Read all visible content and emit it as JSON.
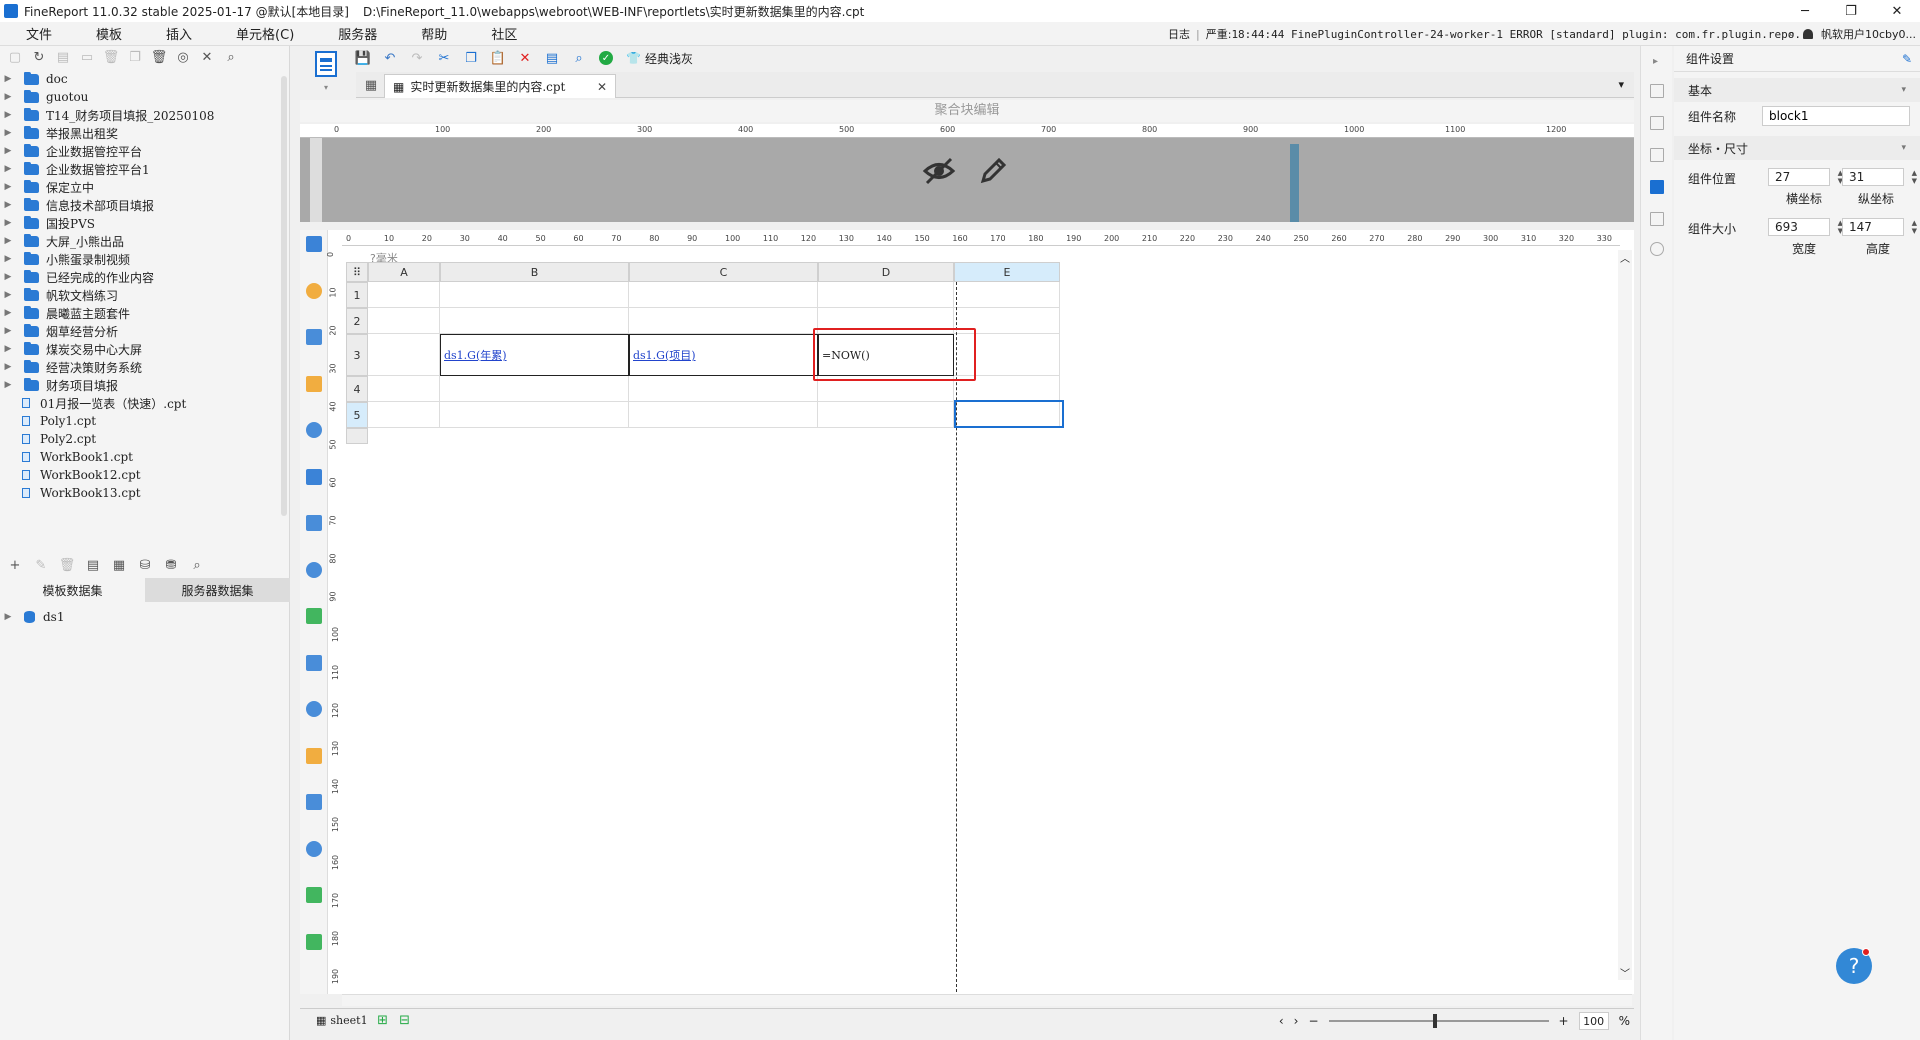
{
  "window": {
    "title": "FineReport 11.0.32 stable 2025-01-17 @默认[本地目录]",
    "path": "D:\\FineReport_11.0\\webapps\\webroot\\WEB-INF\\reportlets\\实时更新数据集里的内容.cpt",
    "minimize": "─",
    "maximize": "❐",
    "close": "✕"
  },
  "menu": {
    "items": [
      "文件",
      "模板",
      "插入",
      "单元格(C)",
      "服务器",
      "帮助",
      "社区"
    ],
    "log_label": "日志",
    "log_level": "严重:",
    "log_text": "18:44:44 FinePluginController-24-worker-1 ERROR [standard] plugin: com.fr.plugin.repo...",
    "user": "帆软用户10cby0..."
  },
  "tree": {
    "items": [
      {
        "type": "folder",
        "label": "doc"
      },
      {
        "type": "folder",
        "label": "guotou"
      },
      {
        "type": "folder",
        "label": "T14_财务项目填报_20250108"
      },
      {
        "type": "folder",
        "label": "举报黑出租奖"
      },
      {
        "type": "folder",
        "label": "企业数据管控平台"
      },
      {
        "type": "folder",
        "label": "企业数据管控平台1"
      },
      {
        "type": "folder",
        "label": "保定立中"
      },
      {
        "type": "folder",
        "label": "信息技术部项目填报"
      },
      {
        "type": "folder",
        "label": "国投PVS"
      },
      {
        "type": "folder",
        "label": "大屏_小熊出品"
      },
      {
        "type": "folder",
        "label": "小熊蛋录制视频"
      },
      {
        "type": "folder",
        "label": "已经完成的作业内容"
      },
      {
        "type": "folder",
        "label": "帆软文档练习"
      },
      {
        "type": "folder",
        "label": "晨曦蓝主题套件"
      },
      {
        "type": "folder",
        "label": "烟草经营分析"
      },
      {
        "type": "folder",
        "label": "煤炭交易中心大屏"
      },
      {
        "type": "folder",
        "label": "经营决策财务系统"
      },
      {
        "type": "folder",
        "label": "财务项目填报"
      },
      {
        "type": "file",
        "label": "01月报一览表（快速）.cpt"
      },
      {
        "type": "file",
        "label": "Poly1.cpt"
      },
      {
        "type": "file",
        "label": "Poly2.cpt"
      },
      {
        "type": "file",
        "label": "WorkBook1.cpt"
      },
      {
        "type": "file",
        "label": "WorkBook12.cpt"
      },
      {
        "type": "file",
        "label": "WorkBook13.cpt"
      }
    ]
  },
  "datasets": {
    "tab_template": "模板数据集",
    "tab_server": "服务器数据集",
    "items": [
      "ds1"
    ]
  },
  "editor": {
    "tab_label": "实时更新数据集里的内容.cpt",
    "template_style_label": "经典浅灰",
    "block_edit_label": "聚合块编辑",
    "unit_label": "?毫米",
    "top_ruler_ticks": [
      "0",
      "100",
      "200",
      "300",
      "400",
      "500",
      "600",
      "700",
      "800",
      "900",
      "1000",
      "1100",
      "1200"
    ],
    "mm_ruler_ticks": [
      "0",
      "10",
      "20",
      "30",
      "40",
      "50",
      "60",
      "70",
      "80",
      "90",
      "100",
      "110",
      "120",
      "130",
      "140",
      "150",
      "160",
      "170",
      "180",
      "190",
      "200",
      "210",
      "220",
      "230",
      "240",
      "250",
      "260",
      "270",
      "280",
      "290",
      "300",
      "310",
      "320",
      "330"
    ],
    "left_ruler_ticks": [
      "0",
      "10",
      "20",
      "30",
      "40",
      "50",
      "60",
      "70",
      "80",
      "90",
      "100",
      "110",
      "120",
      "130",
      "140",
      "150",
      "160",
      "170",
      "180",
      "190"
    ],
    "columns": [
      "A",
      "B",
      "C",
      "D",
      "E"
    ],
    "rows": [
      "1",
      "2",
      "3",
      "4",
      "5"
    ],
    "cells": {
      "B3": "ds1.G(年累)",
      "C3": "ds1.G(项目)",
      "D3": "=NOW()"
    }
  },
  "statusbar": {
    "sheet": "sheet1",
    "zoom": "100",
    "percent": "%"
  },
  "props": {
    "title": "组件设置",
    "section_basic": "基本",
    "name_label": "组件名称",
    "name_value": "block1",
    "section_coord": "坐标・尺寸",
    "position_label": "组件位置",
    "x_value": "27",
    "y_value": "31",
    "x_sub": "横坐标",
    "y_sub": "纵坐标",
    "size_label": "组件大小",
    "w_value": "693",
    "h_value": "147",
    "w_sub": "宽度",
    "h_sub": "高度"
  },
  "help": "?"
}
